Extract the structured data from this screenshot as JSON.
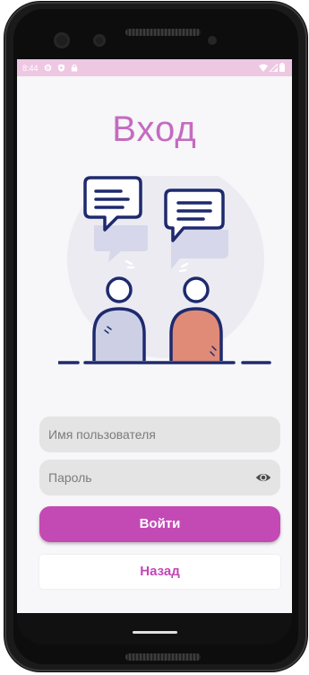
{
  "status_bar": {
    "time": "8:44"
  },
  "login": {
    "title": "Вход",
    "username_placeholder": "Имя пользователя",
    "password_placeholder": "Пароль",
    "login_button": "Войти",
    "back_button": "Назад"
  },
  "colors": {
    "accent": "#c34ab4",
    "title": "#c46bc1",
    "status_bar": "#eec7e2",
    "field_bg": "#e4e4e4",
    "person_left": "#cdd0e4",
    "person_right": "#df8b78",
    "outline": "#1e2a6e"
  },
  "icons": {
    "status": [
      "settings-icon",
      "shield-icon",
      "lock-icon",
      "wifi-icon",
      "signal-icon",
      "battery-icon"
    ],
    "password_toggle": "eye-icon",
    "illustration": "chat-people-illustration"
  }
}
